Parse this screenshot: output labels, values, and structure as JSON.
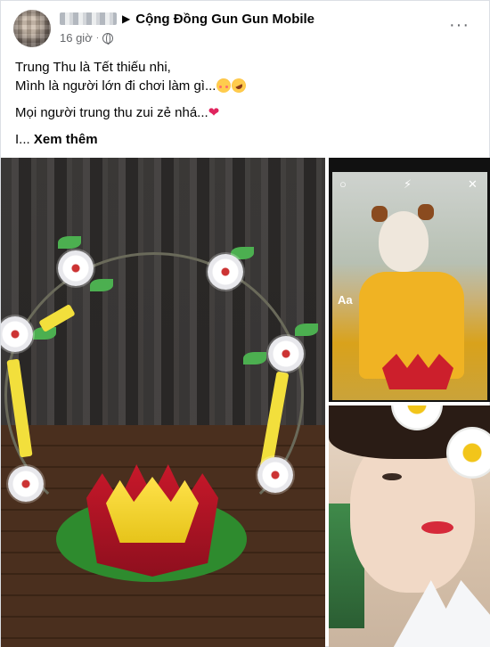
{
  "post": {
    "author_blurred": "",
    "group_name": "Cộng Đồng Gun Gun Mobile",
    "time": "16 giờ",
    "separator": "·",
    "privacy_icon": "globe-icon",
    "more_icon": "more-options-icon"
  },
  "content": {
    "line1": "Trung Thu là Tết thiếu nhi,",
    "line2": "Mình là người lớn đi chơi làm gì...",
    "line3": "Mọi người trung thu zui zẻ nhá...",
    "line4_prefix": "I... ",
    "see_more": "Xem thêm",
    "emojis": [
      "flushed-face-emoji",
      "rolling-laughing-emoji",
      "red-heart-emoji"
    ]
  },
  "photos": {
    "main_desc_icon": "lantern-photo",
    "top_overlay_text": "Aa"
  }
}
